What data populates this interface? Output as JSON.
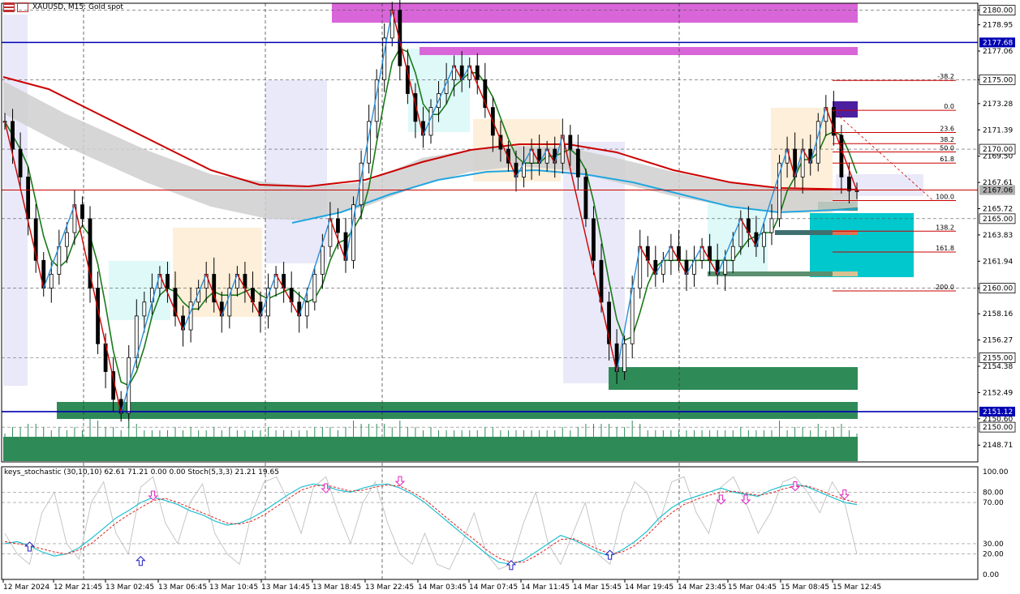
{
  "header": {
    "symbol_text": "XAUUSD, M15:  Gold spot"
  },
  "indicator": {
    "title": "keys_stochastic (30,10,10) 62.61 71.21 0.00 0.00 Stoch(5,3,3) 21.21 19.65"
  },
  "colors": {
    "red_line": "#cc0000",
    "blue_line": "#2b8fd9",
    "green_ma": "#1a7a1a",
    "navy_level": "#0000b3",
    "cyan_ma": "#22a6e0",
    "zone_green": "#2e8b57",
    "zone_magenta": "#d966d9",
    "zone_lavender": "#e4e4f7",
    "zone_peach": "#fdebd0",
    "zone_cyan": "#d7f7f7",
    "zone_teal": "#00c8cc",
    "zone_purple": "#4b1fa0",
    "volume": "#2e8b57"
  },
  "chart_data": {
    "type": "candlestick",
    "symbol": "XAUUSD",
    "timeframe": "M15",
    "price_axis": {
      "min": 2147.5,
      "max": 2180.5,
      "ticks": [
        "2180.00",
        "2178.95",
        "2177.06",
        "2175.00",
        "2173.28",
        "2171.39",
        "2169.50",
        "2167.61",
        "2165.72",
        "2163.83",
        "2161.94",
        "2160.00",
        "2158.16",
        "2156.27",
        "2154.38",
        "2152.49",
        "2150.60",
        "2148.71"
      ]
    },
    "price_tags": [
      {
        "text": "2180.00",
        "value": 2180.0,
        "style": "white"
      },
      {
        "text": "2177.68",
        "value": 2177.68,
        "style": "navy"
      },
      {
        "text": "2175.00",
        "value": 2175.0,
        "style": "white"
      },
      {
        "text": "2170.00",
        "value": 2170.0,
        "style": "white"
      },
      {
        "text": "2167.06",
        "value": 2167.06,
        "style": "grey"
      },
      {
        "text": "2165.00",
        "value": 2165.0,
        "style": "white"
      },
      {
        "text": "2160.00",
        "value": 2160.0,
        "style": "white"
      },
      {
        "text": "2155.00",
        "value": 2155.0,
        "style": "white"
      },
      {
        "text": "2151.12",
        "value": 2151.12,
        "style": "navy"
      },
      {
        "text": "2150.00",
        "value": 2150.0,
        "style": "white"
      }
    ],
    "time_axis": [
      "12 Mar 2024",
      "12 Mar 21:45",
      "13 Mar 02:45",
      "13 Mar 06:45",
      "13 Mar 10:45",
      "13 Mar 14:45",
      "13 Mar 18:45",
      "13 Mar 22:45",
      "14 Mar 03:45",
      "14 Mar 07:45",
      "14 Mar 11:45",
      "14 Mar 15:45",
      "14 Mar 19:45",
      "14 Mar 23:45",
      "15 Mar 04:45",
      "15 Mar 08:45",
      "15 Mar 12:45"
    ],
    "levels": [
      {
        "value": 2177.68,
        "color": "navy"
      },
      {
        "value": 2151.12,
        "color": "navy"
      },
      {
        "value": 2167.06,
        "color": "red"
      }
    ],
    "fibonacci": [
      {
        "level": "-38.2",
        "price": 2174.95
      },
      {
        "level": "0.0",
        "price": 2172.8
      },
      {
        "level": "23.6",
        "price": 2171.2
      },
      {
        "level": "38.2",
        "price": 2170.4
      },
      {
        "level": "50.0",
        "price": 2169.8
      },
      {
        "level": "61.8",
        "price": 2169.0
      },
      {
        "level": "100.0",
        "price": 2166.3
      },
      {
        "level": "138.2",
        "price": 2164.1
      },
      {
        "level": "161.8",
        "price": 2162.6
      },
      {
        "level": "200.0",
        "price": 2159.8
      }
    ],
    "close_series": [
      2172,
      2170,
      2168,
      2165,
      2162,
      2160,
      2161,
      2163,
      2164,
      2166,
      2165,
      2160,
      2156,
      2154,
      2152,
      2151,
      2155,
      2158,
      2159,
      2160,
      2161,
      2160,
      2158,
      2157,
      2159,
      2160,
      2161,
      2159,
      2158,
      2160,
      2161,
      2160,
      2159,
      2158,
      2160,
      2161,
      2160,
      2159,
      2158,
      2159,
      2161,
      2163,
      2165,
      2164,
      2162,
      2166,
      2169,
      2172,
      2175,
      2178,
      2180,
      2176,
      2174,
      2172,
      2171,
      2173,
      2174,
      2175,
      2176,
      2175,
      2176,
      2175,
      2173,
      2171,
      2170,
      2169,
      2168,
      2169,
      2170,
      2169,
      2170,
      2169,
      2171,
      2170,
      2168,
      2165,
      2162,
      2159,
      2156,
      2154,
      2156,
      2160,
      2163,
      2162,
      2161,
      2162,
      2163,
      2162,
      2161,
      2162,
      2163,
      2162,
      2161,
      2162,
      2163,
      2165,
      2164,
      2163,
      2164,
      2165,
      2169,
      2170,
      2168,
      2170,
      2169,
      2172,
      2173,
      2171,
      2168,
      2167,
      2167
    ]
  },
  "stochastic": {
    "axis_ticks": [
      "100.00",
      "80.00",
      "70.00",
      "30.00",
      "20.00",
      "0.00"
    ],
    "min": 0,
    "max": 100,
    "main": [
      30,
      32,
      28,
      22,
      18,
      20,
      26,
      35,
      45,
      55,
      62,
      70,
      75,
      72,
      68,
      62,
      58,
      52,
      48,
      50,
      55,
      62,
      70,
      78,
      85,
      88,
      86,
      82,
      80,
      84,
      87,
      88,
      84,
      78,
      70,
      60,
      50,
      40,
      30,
      20,
      12,
      10,
      14,
      22,
      30,
      38,
      34,
      28,
      22,
      18,
      24,
      32,
      42,
      55,
      65,
      72,
      76,
      80,
      84,
      80,
      78,
      76,
      82,
      86,
      88,
      85,
      80,
      75,
      70,
      68
    ],
    "signal": [
      32,
      30,
      28,
      25,
      22,
      20,
      24,
      30,
      40,
      50,
      58,
      65,
      72,
      74,
      70,
      65,
      60,
      55,
      50,
      49,
      52,
      58,
      66,
      74,
      82,
      86,
      87,
      84,
      81,
      82,
      85,
      87,
      86,
      80,
      73,
      63,
      53,
      43,
      34,
      24,
      16,
      12,
      12,
      18,
      26,
      34,
      35,
      30,
      25,
      20,
      22,
      28,
      38,
      50,
      60,
      68,
      73,
      77,
      80,
      81,
      79,
      77,
      79,
      83,
      86,
      86,
      82,
      77,
      73,
      70
    ],
    "fast": [
      40,
      20,
      10,
      60,
      80,
      30,
      15,
      70,
      90,
      40,
      20,
      85,
      95,
      50,
      30,
      70,
      88,
      40,
      20,
      10,
      60,
      90,
      95,
      70,
      40,
      85,
      95,
      60,
      30,
      70,
      90,
      50,
      20,
      10,
      40,
      10,
      5,
      30,
      60,
      20,
      5,
      10,
      50,
      80,
      30,
      10,
      40,
      70,
      20,
      10,
      60,
      90,
      80,
      50,
      90,
      95,
      60,
      40,
      85,
      95,
      70,
      40,
      60,
      90,
      95,
      80,
      60,
      90,
      70,
      20
    ],
    "up_arrows": [
      {
        "i": 2,
        "v": 26
      },
      {
        "i": 11,
        "v": 12
      },
      {
        "i": 41,
        "v": 8
      },
      {
        "i": 49,
        "v": 18
      }
    ],
    "down_arrows": [
      {
        "i": 12,
        "v": 78
      },
      {
        "i": 26,
        "v": 85
      },
      {
        "i": 32,
        "v": 92
      },
      {
        "i": 58,
        "v": 74
      },
      {
        "i": 60,
        "v": 74
      },
      {
        "i": 64,
        "v": 87
      },
      {
        "i": 68,
        "v": 79
      }
    ]
  }
}
